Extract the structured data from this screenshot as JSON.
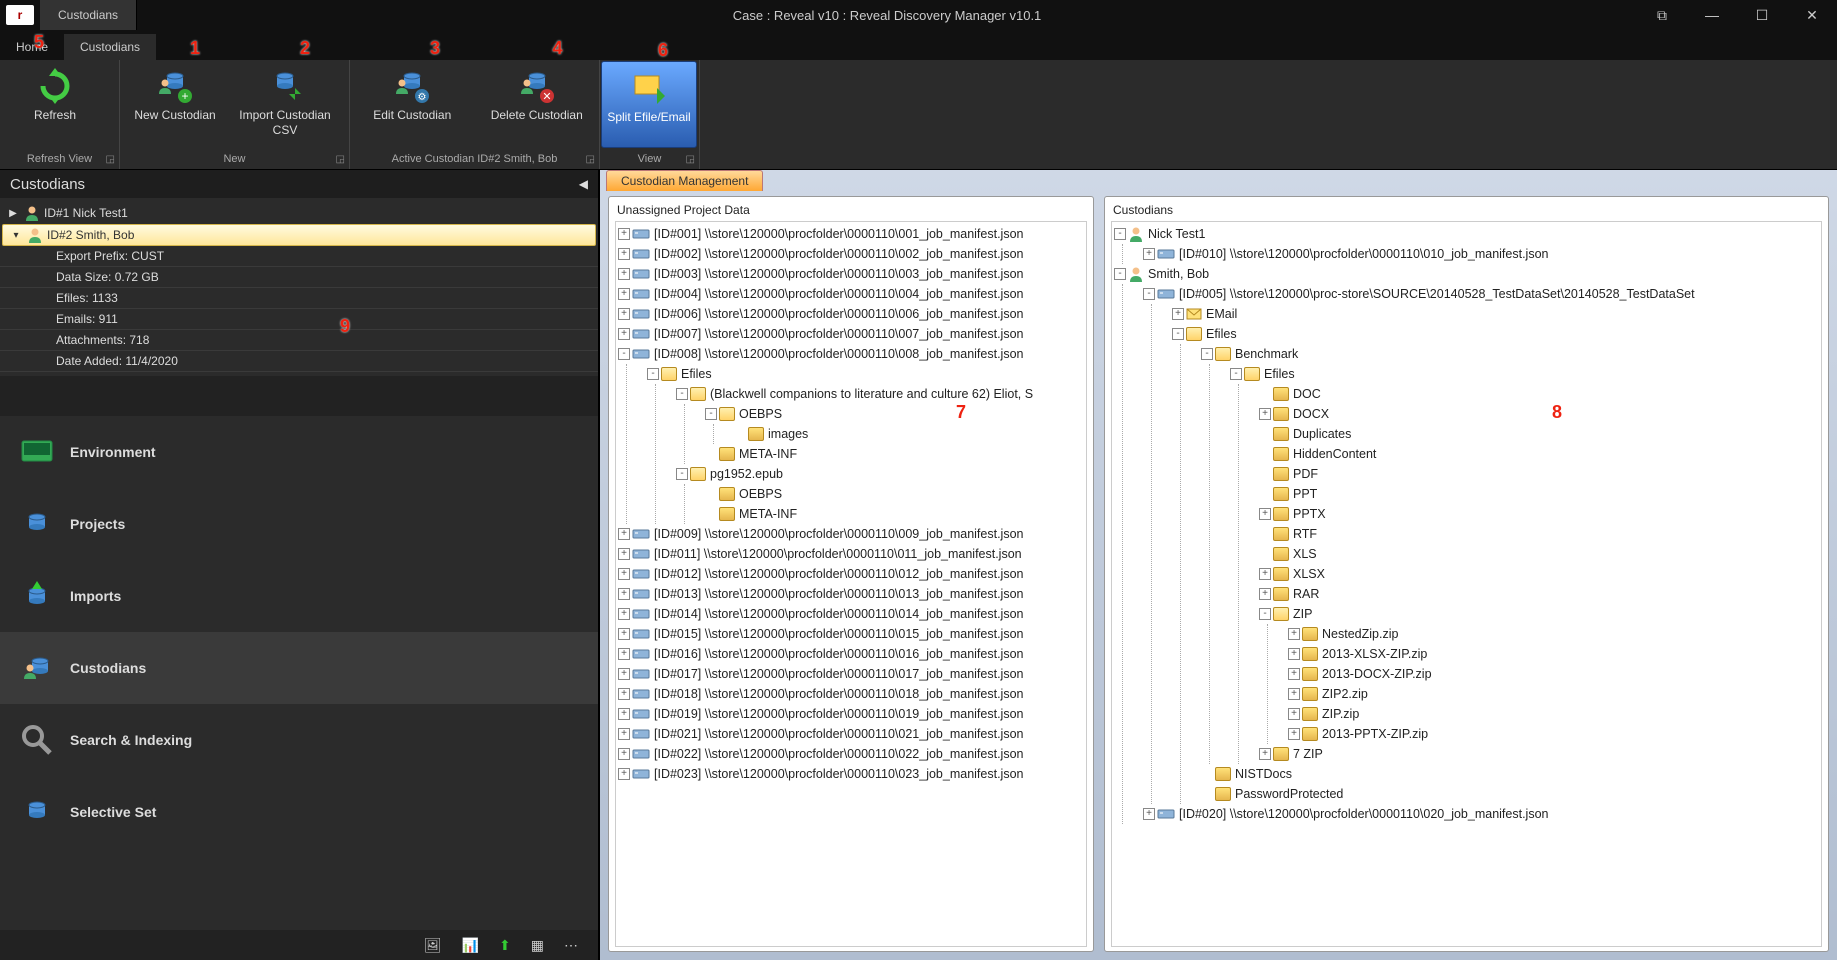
{
  "window": {
    "app_letter": "r",
    "mini_tab": "Custodians",
    "title": "Case : Reveal v10 : Reveal Discovery Manager  v10.1"
  },
  "ribbon_tabs": {
    "home": "Home",
    "custodians": "Custodians"
  },
  "ribbon": {
    "refresh": "Refresh",
    "new_custodian": "New Custodian",
    "import_csv": "Import Custodian CSV",
    "edit_custodian": "Edit Custodian",
    "delete_custodian": "Delete Custodian",
    "split": "Split Efile/Email",
    "group_refresh": "Refresh View",
    "group_new": "New",
    "group_active": "Active Custodian ID#2 Smith, Bob",
    "group_view": "View"
  },
  "callouts": {
    "c1": "1",
    "c2": "2",
    "c3": "3",
    "c4": "4",
    "c5": "5",
    "c6": "6",
    "c7": "7",
    "c8": "8",
    "c9": "9"
  },
  "left": {
    "header": "Custodians",
    "rows": {
      "r1": "ID#1 Nick Test1",
      "r2": "ID#2 Smith, Bob"
    },
    "details": {
      "export_prefix": "Export Prefix: CUST",
      "data_size": "Data Size: 0.72 GB",
      "efiles": "Efiles: 1133",
      "emails": "Emails: 911",
      "attachments": "Attachments: 718",
      "date_added": "Date Added: 11/4/2020"
    },
    "nav": {
      "environment": "Environment",
      "projects": "Projects",
      "imports": "Imports",
      "custodians": "Custodians",
      "search": "Search & Indexing",
      "selective": "Selective Set"
    }
  },
  "right": {
    "tab": "Custodian Management",
    "left_title": "Unassigned Project Data",
    "right_title": "Custodians",
    "unassigned": {
      "n001": "[ID#001]  \\\\store\\120000\\procfolder\\0000110\\001_job_manifest.json",
      "n002": "[ID#002]  \\\\store\\120000\\procfolder\\0000110\\002_job_manifest.json",
      "n003": "[ID#003]  \\\\store\\120000\\procfolder\\0000110\\003_job_manifest.json",
      "n004": "[ID#004]  \\\\store\\120000\\procfolder\\0000110\\004_job_manifest.json",
      "n006": "[ID#006]  \\\\store\\120000\\procfolder\\0000110\\006_job_manifest.json",
      "n007": "[ID#007]  \\\\store\\120000\\procfolder\\0000110\\007_job_manifest.json",
      "n008": "[ID#008]  \\\\store\\120000\\procfolder\\0000110\\008_job_manifest.json",
      "n008_efiles": "Efiles",
      "n008_book": "(Blackwell companions to literature and culture 62) Eliot, S",
      "oebps": "OEBPS",
      "images": "images",
      "metainf": "META-INF",
      "pg1952": "pg1952.epub",
      "n009": "[ID#009]  \\\\store\\120000\\procfolder\\0000110\\009_job_manifest.json",
      "n011": "[ID#011]  \\\\store\\120000\\procfolder\\0000110\\011_job_manifest.json",
      "n012": "[ID#012]  \\\\store\\120000\\procfolder\\0000110\\012_job_manifest.json",
      "n013": "[ID#013]  \\\\store\\120000\\procfolder\\0000110\\013_job_manifest.json",
      "n014": "[ID#014]  \\\\store\\120000\\procfolder\\0000110\\014_job_manifest.json",
      "n015": "[ID#015]  \\\\store\\120000\\procfolder\\0000110\\015_job_manifest.json",
      "n016": "[ID#016]  \\\\store\\120000\\procfolder\\0000110\\016_job_manifest.json",
      "n017": "[ID#017]  \\\\store\\120000\\procfolder\\0000110\\017_job_manifest.json",
      "n018": "[ID#018]  \\\\store\\120000\\procfolder\\0000110\\018_job_manifest.json",
      "n019": "[ID#019]  \\\\store\\120000\\procfolder\\0000110\\019_job_manifest.json",
      "n021": "[ID#021]  \\\\store\\120000\\procfolder\\0000110\\021_job_manifest.json",
      "n022": "[ID#022]  \\\\store\\120000\\procfolder\\0000110\\022_job_manifest.json",
      "n023": "[ID#023]  \\\\store\\120000\\procfolder\\0000110\\023_job_manifest.json"
    },
    "custodians": {
      "nick": "Nick Test1",
      "nick_010": "[ID#010]  \\\\store\\120000\\procfolder\\0000110\\010_job_manifest.json",
      "smith": "Smith, Bob",
      "smith_005": "[ID#005]  \\\\store\\120000\\proc-store\\SOURCE\\20140528_TestDataSet\\20140528_TestDataSet",
      "email": "EMail",
      "efiles": "Efiles",
      "benchmark": "Benchmark",
      "efiles2": "Efiles",
      "doc": "DOC",
      "docx": "DOCX",
      "duplicates": "Duplicates",
      "hidden": "HiddenContent",
      "pdf": "PDF",
      "ppt": "PPT",
      "pptx": "PPTX",
      "rtf": "RTF",
      "xls": "XLS",
      "xlsx": "XLSX",
      "rar": "RAR",
      "zip": "ZIP",
      "nestedzip": "NestedZip.zip",
      "xlsxzip": "2013-XLSX-ZIP.zip",
      "docxzip": "2013-DOCX-ZIP.zip",
      "zip2": "ZIP2.zip",
      "zipzip": "ZIP.zip",
      "pptxzip": "2013-PPTX-ZIP.zip",
      "sevenzip": "7 ZIP",
      "nistdocs": "NISTDocs",
      "pwprot": "PasswordProtected",
      "n020": "[ID#020]  \\\\store\\120000\\procfolder\\0000110\\020_job_manifest.json"
    }
  }
}
